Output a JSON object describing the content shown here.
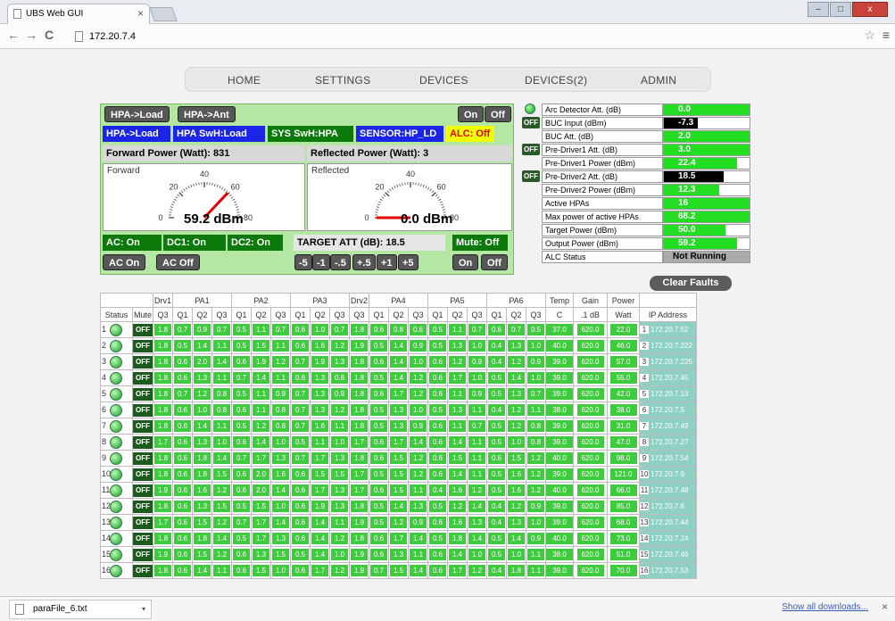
{
  "browser": {
    "tab_title": "UBS Web GUI",
    "tab_close": "×",
    "url": "172.20.7.4",
    "back": "←",
    "forward": "→",
    "reload": "C",
    "star": "☆",
    "menu": "≡"
  },
  "nav": {
    "items": [
      "HOME",
      "SETTINGS",
      "DEVICES",
      "DEVICES(2)",
      "ADMIN"
    ]
  },
  "controls": {
    "hpa_load_btn": "HPA->Load",
    "hpa_ant_btn": "HPA->Ant",
    "on_btn": "On",
    "off_btn": "Off",
    "status_hpa_load": "HPA->Load",
    "status_hpa_sw": "HPA SwH:Load",
    "status_sys_sw": "SYS SwH:HPA",
    "status_sensor": "SENSOR:HP_LD",
    "status_alc": "ALC: Off",
    "forward_power": "Forward Power (Watt): 831",
    "reflected_power": "Reflected Power (Watt): 3",
    "forward_title": "Forward",
    "reflected_title": "Reflected",
    "forward_value": "59.2 dBm",
    "reflected_value": "0.0 dBm",
    "gauge_labels": [
      "0",
      "20",
      "40",
      "60",
      "80"
    ],
    "forward_needle": 59.2,
    "reflected_needle": 0.0,
    "ac_on_status": "AC: On",
    "dc1_status": "DC1: On",
    "dc2_status": "DC2: On",
    "target_att": "TARGET ATT (dB): 18.5",
    "mute_status": "Mute: Off",
    "ac_on_btn": "AC On",
    "ac_off_btn": "AC Off",
    "step_btns": [
      "-5",
      "-1",
      "-.5",
      "+.5",
      "+1",
      "+5"
    ],
    "on_btn2": "On",
    "off_btn2": "Off"
  },
  "params": [
    {
      "label": "Arc Detector Att. (dB)",
      "value": "0.0",
      "fill": 1.0,
      "color": "#22dd22",
      "ctrl": "led"
    },
    {
      "label": "BUC Input (dBm)",
      "value": "-7.3",
      "fill": 0.4,
      "color": "#000000",
      "ctrl": "off",
      "ctrl_label": "OFF"
    },
    {
      "label": "BUC Att. (dB)",
      "value": "2.0",
      "fill": 1.0,
      "color": "#22dd22",
      "ctrl": ""
    },
    {
      "label": "Pre-Driver1 Att. (dB)",
      "value": "3.0",
      "fill": 1.0,
      "color": "#22dd22",
      "ctrl": "off",
      "ctrl_label": "OFF"
    },
    {
      "label": "Pre-Driver1 Power (dBm)",
      "value": "22.4",
      "fill": 0.85,
      "color": "#22dd22",
      "ctrl": ""
    },
    {
      "label": "Pre-Driver2 Att. (dB)",
      "value": "18.5",
      "fill": 0.7,
      "color": "#000000",
      "ctrl": "off",
      "ctrl_label": "OFF"
    },
    {
      "label": "Pre-Driver2 Power (dBm)",
      "value": "12.3",
      "fill": 0.65,
      "color": "#22dd22",
      "ctrl": ""
    },
    {
      "label": "Active HPAs",
      "value": "16",
      "fill": 1.0,
      "color": "#22dd22",
      "ctrl": ""
    },
    {
      "label": "Max power of active HPAs",
      "value": "68.2",
      "fill": 1.0,
      "color": "#22dd22",
      "ctrl": ""
    },
    {
      "label": "Target Power (dBm)",
      "value": "50.0",
      "fill": 0.72,
      "color": "#22dd22",
      "ctrl": ""
    },
    {
      "label": "Output Power (dBm)",
      "value": "59.2",
      "fill": 0.85,
      "color": "#22dd22",
      "ctrl": ""
    },
    {
      "label": "ALC Status",
      "value": "Not Running",
      "fill": 1.0,
      "color": "#aaaaaa",
      "ctrl": ""
    }
  ],
  "clear_faults": "Clear Faults",
  "grid": {
    "group_headers": [
      "Drv1",
      "PA1",
      "PA2",
      "PA3",
      "Drv2",
      "PA4",
      "PA5",
      "PA6",
      "Temp",
      "Gain",
      "Power"
    ],
    "col_headers": [
      "Status",
      "Mute",
      "Q3",
      "Q1",
      "Q2",
      "Q3",
      "Q1",
      "Q2",
      "Q3",
      "Q1",
      "Q2",
      "Q3",
      "Q3",
      "Q1",
      "Q2",
      "Q3",
      "Q1",
      "Q2",
      "Q3",
      "Q1",
      "Q2",
      "Q3",
      "C",
      ".1 dB",
      "Watt",
      "IP Address"
    ],
    "mute_label": "OFF",
    "rows": [
      {
        "n": "1",
        "v": [
          "1.8",
          "0.7",
          "0.9",
          "0.7",
          "0.5",
          "1.1",
          "0.7",
          "0.6",
          "1.0",
          "0.7",
          "1.8",
          "0.6",
          "0.8",
          "0.6",
          "0.5",
          "1.1",
          "0.7",
          "0.6",
          "0.7",
          "0.5",
          "37.0",
          "620.0",
          "22.0"
        ],
        "ip": "172.20.7.52"
      },
      {
        "n": "2",
        "v": [
          "1.8",
          "0.5",
          "1.4",
          "1.1",
          "0.5",
          "1.5",
          "1.1",
          "0.6",
          "1.6",
          "1.2",
          "1.9",
          "0.5",
          "1.4",
          "0.9",
          "0.5",
          "1.3",
          "1.0",
          "0.4",
          "1.3",
          "1.0",
          "40.0",
          "620.0",
          "46.0"
        ],
        "ip": "172.20.7.222"
      },
      {
        "n": "3",
        "v": [
          "1.8",
          "0.6",
          "2.0",
          "1.4",
          "0.6",
          "1.9",
          "1.2",
          "0.7",
          "1.9",
          "1.3",
          "1.8",
          "0.6",
          "1.4",
          "1.0",
          "0.6",
          "1.2",
          "0.9",
          "0.4",
          "1.2",
          "0.9",
          "39.0",
          "620.0",
          "57.0"
        ],
        "ip": "172.20.7.225"
      },
      {
        "n": "4",
        "v": [
          "1.8",
          "0.6",
          "1.3",
          "1.1",
          "0.7",
          "1.4",
          "1.1",
          "0.6",
          "1.3",
          "0.8",
          "1.8",
          "0.5",
          "1.4",
          "1.2",
          "0.6",
          "1.7",
          "1.0",
          "0.5",
          "1.4",
          "1.0",
          "39.0",
          "620.0",
          "55.0"
        ],
        "ip": "172.20.7.45"
      },
      {
        "n": "5",
        "v": [
          "1.8",
          "0.7",
          "1.2",
          "0.8",
          "0.5",
          "1.1",
          "0.9",
          "0.7",
          "1.3",
          "0.9",
          "1.8",
          "0.6",
          "1.7",
          "1.2",
          "0.6",
          "1.1",
          "0.9",
          "0.5",
          "1.3",
          "0.7",
          "39.0",
          "620.0",
          "42.0"
        ],
        "ip": "172.20.7.13"
      },
      {
        "n": "6",
        "v": [
          "1.8",
          "0.6",
          "1.0",
          "0.8",
          "0.6",
          "1.1",
          "0.8",
          "0.7",
          "1.3",
          "1.2",
          "1.8",
          "0.5",
          "1.3",
          "1.0",
          "0.5",
          "1.3",
          "1.1",
          "0.4",
          "1.2",
          "1.1",
          "38.0",
          "620.0",
          "38.0"
        ],
        "ip": "172.20.7.5"
      },
      {
        "n": "7",
        "v": [
          "1.8",
          "0.6",
          "1.4",
          "1.1",
          "0.5",
          "1.2",
          "0.8",
          "0.7",
          "1.6",
          "1.1",
          "1.8",
          "0.5",
          "1.3",
          "0.9",
          "0.6",
          "1.1",
          "0.7",
          "0.5",
          "1.2",
          "0.8",
          "39.0",
          "620.0",
          "31.0"
        ],
        "ip": "172.20.7.49"
      },
      {
        "n": "8",
        "v": [
          "1.7",
          "0.6",
          "1.3",
          "1.0",
          "0.6",
          "1.4",
          "1.0",
          "0.5",
          "1.1",
          "1.0",
          "1.7",
          "0.6",
          "1.7",
          "1.4",
          "0.6",
          "1.4",
          "1.1",
          "0.5",
          "1.0",
          "0.8",
          "39.0",
          "620.0",
          "47.0"
        ],
        "ip": "172.20.7.27"
      },
      {
        "n": "9",
        "v": [
          "1.8",
          "0.6",
          "1.8",
          "1.4",
          "0.7",
          "1.7",
          "1.3",
          "0.7",
          "1.7",
          "1.3",
          "1.8",
          "0.6",
          "1.5",
          "1.2",
          "0.6",
          "1.5",
          "1.1",
          "0.6",
          "1.5",
          "1.2",
          "40.0",
          "620.0",
          "98.0"
        ],
        "ip": "172.20.7.54"
      },
      {
        "n": "10",
        "v": [
          "1.8",
          "0.6",
          "1.8",
          "1.5",
          "0.6",
          "2.0",
          "1.6",
          "0.6",
          "1.5",
          "1.5",
          "1.7",
          "0.5",
          "1.5",
          "1.2",
          "0.6",
          "1.4",
          "1.1",
          "0.5",
          "1.6",
          "1.2",
          "39.0",
          "620.0",
          "121.0"
        ],
        "ip": "172.20.7.9"
      },
      {
        "n": "11",
        "v": [
          "1.9",
          "0.6",
          "1.6",
          "1.2",
          "0.6",
          "2.0",
          "1.4",
          "0.6",
          "1.7",
          "1.3",
          "1.7",
          "0.6",
          "1.5",
          "1.1",
          "0.4",
          "1.6",
          "1.2",
          "0.5",
          "1.6",
          "1.2",
          "40.0",
          "620.0",
          "66.0"
        ],
        "ip": "172.20.7.48"
      },
      {
        "n": "12",
        "v": [
          "1.8",
          "0.6",
          "1.3",
          "1.5",
          "0.5",
          "1.5",
          "1.0",
          "0.6",
          "1.9",
          "1.3",
          "1.8",
          "0.5",
          "1.4",
          "1.3",
          "0.5",
          "1.2",
          "1.4",
          "0.4",
          "1.2",
          "0.9",
          "39.0",
          "620.0",
          "85.0"
        ],
        "ip": "172.20.7.6"
      },
      {
        "n": "13",
        "v": [
          "1.7",
          "0.6",
          "1.5",
          "1.2",
          "0.7",
          "1.7",
          "1.4",
          "0.6",
          "1.4",
          "1.1",
          "1.9",
          "0.5",
          "1.2",
          "0.9",
          "0.6",
          "1.6",
          "1.3",
          "0.4",
          "1.3",
          "1.0",
          "39.0",
          "620.0",
          "68.0"
        ],
        "ip": "172.20.7.44"
      },
      {
        "n": "14",
        "v": [
          "1.8",
          "0.6",
          "1.8",
          "1.4",
          "0.5",
          "1.7",
          "1.3",
          "0.6",
          "1.4",
          "1.2",
          "1.8",
          "0.6",
          "1.7",
          "1.4",
          "0.5",
          "1.8",
          "1.4",
          "0.5",
          "1.4",
          "0.9",
          "40.0",
          "620.0",
          "73.0"
        ],
        "ip": "172.20.7.24"
      },
      {
        "n": "15",
        "v": [
          "1.9",
          "0.6",
          "1.5",
          "1.2",
          "0.6",
          "1.3",
          "1.5",
          "0.5",
          "1.4",
          "1.0",
          "1.9",
          "0.6",
          "1.3",
          "1.1",
          "0.6",
          "1.4",
          "1.0",
          "0.5",
          "1.0",
          "1.1",
          "38.0",
          "620.0",
          "51.0"
        ],
        "ip": "172.20.7.46"
      },
      {
        "n": "16",
        "v": [
          "1.8",
          "0.6",
          "1.4",
          "1.1",
          "0.6",
          "1.5",
          "1.0",
          "0.6",
          "1.7",
          "1.2",
          "1.9",
          "0.7",
          "1.5",
          "1.4",
          "0.6",
          "1.7",
          "1.2",
          "0.4",
          "1.8",
          "1.1",
          "39.0",
          "620.0",
          "70.0"
        ],
        "ip": "172.20.7.53"
      }
    ]
  },
  "downloads": {
    "file": "paraFile_6.txt",
    "show_all": "Show all downloads...",
    "close": "×"
  },
  "colors": {
    "panel_bg": "#b4e6a4",
    "cell_green": "#3ecb3e",
    "ip_bg": "#8ed1c4",
    "blue_label": "#1b25e8",
    "dark_green_label": "#0b7a0b",
    "alc_yellow": "#f2ff00"
  }
}
